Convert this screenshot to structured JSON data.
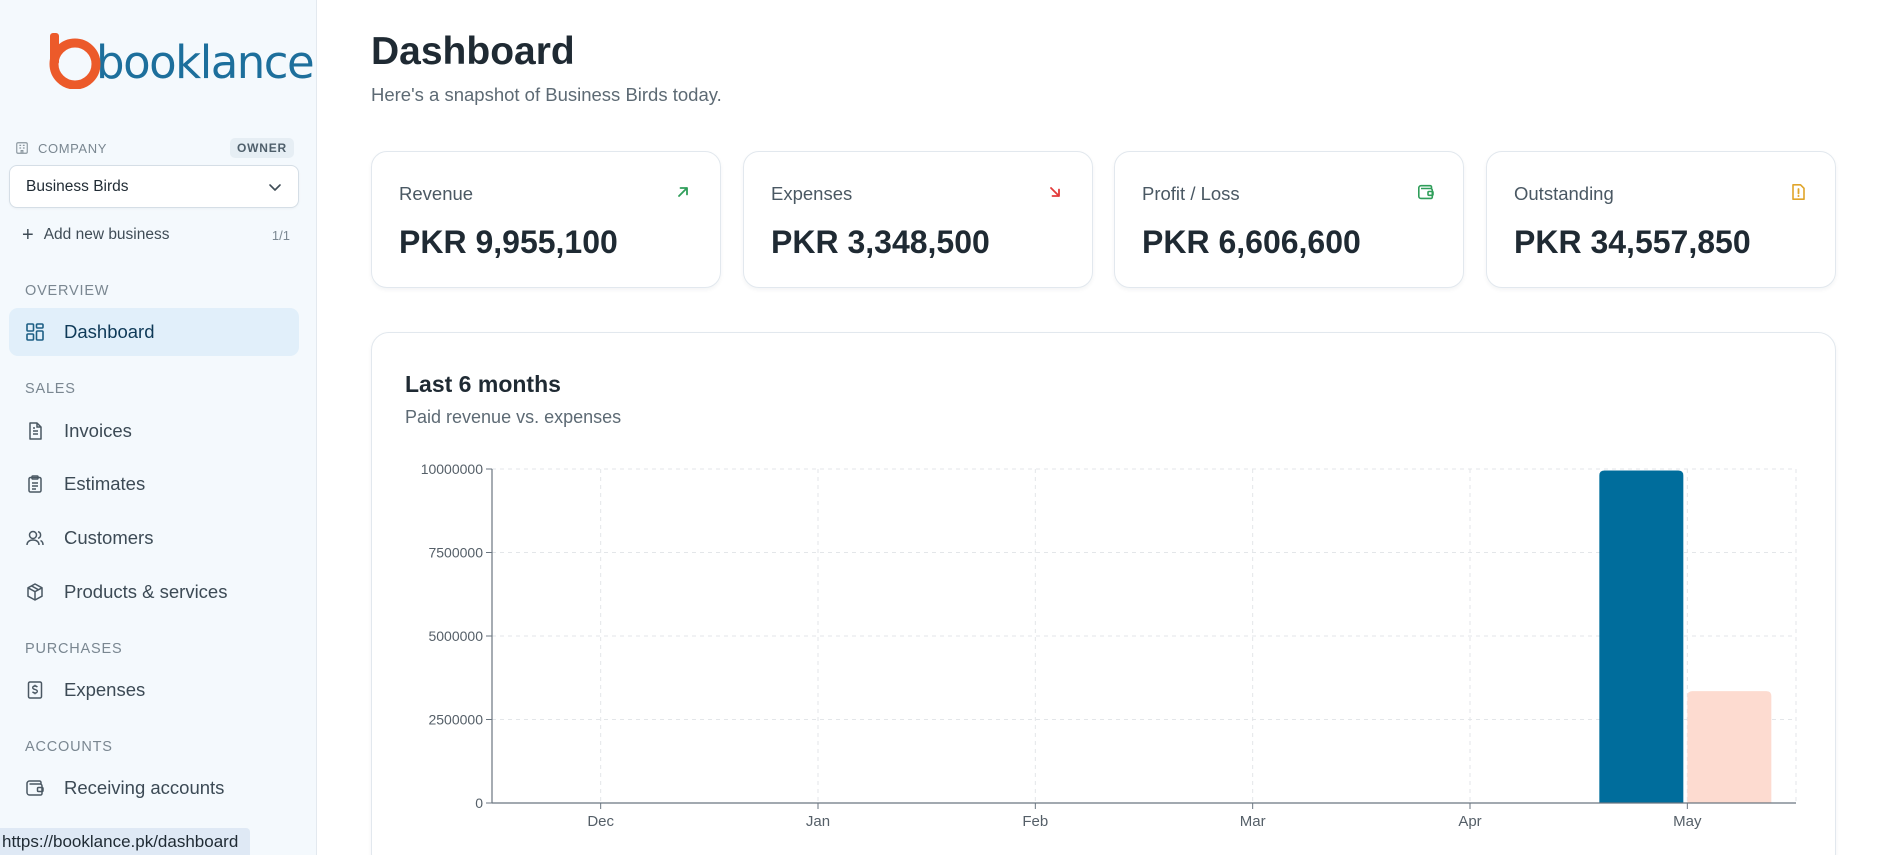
{
  "sidebar": {
    "logo_text": "booklance",
    "company_label": "COMPANY",
    "owner_badge": "OWNER",
    "company_selected": "Business Birds",
    "add_business": "Add new business",
    "business_count": "1/1",
    "sections": {
      "overview": "OVERVIEW",
      "sales": "SALES",
      "purchases": "PURCHASES",
      "accounts": "ACCOUNTS"
    },
    "items": {
      "dashboard": "Dashboard",
      "invoices": "Invoices",
      "estimates": "Estimates",
      "customers": "Customers",
      "products": "Products & services",
      "expenses": "Expenses",
      "receiving_accounts": "Receiving accounts"
    }
  },
  "status_url": "https://booklance.pk/dashboard",
  "header": {
    "title": "Dashboard",
    "subtitle": "Here's a snapshot of Business Birds today."
  },
  "cards": [
    {
      "label": "Revenue",
      "value": "PKR 9,955,100",
      "icon": "arrow-up-right-icon",
      "color": "#2f9e5a"
    },
    {
      "label": "Expenses",
      "value": "PKR 3,348,500",
      "icon": "arrow-down-right-icon",
      "color": "#e23b3b"
    },
    {
      "label": "Profit / Loss",
      "value": "PKR 6,606,600",
      "icon": "wallet-icon",
      "color": "#2f9e5a"
    },
    {
      "label": "Outstanding",
      "value": "PKR 34,557,850",
      "icon": "alert-note-icon",
      "color": "#e0a52a"
    }
  ],
  "chart_card": {
    "title": "Last 6 months",
    "subtitle": "Paid revenue vs. expenses"
  },
  "chart_data": {
    "type": "bar",
    "categories": [
      "Dec",
      "Jan",
      "Feb",
      "Mar",
      "Apr",
      "May"
    ],
    "series": [
      {
        "values": [
          0,
          0,
          0,
          0,
          0,
          9955100
        ],
        "color": "#006d9c"
      },
      {
        "values": [
          0,
          0,
          0,
          0,
          0,
          3348500
        ],
        "color": "#fddbd0"
      }
    ],
    "yticks": [
      "0",
      "2500000",
      "5000000",
      "7500000",
      "10000000"
    ],
    "ylim": [
      0,
      10000000
    ],
    "grid": true
  },
  "colors": {
    "brand_orange": "#ec5a2a",
    "brand_blue": "#1d6f9c",
    "active_nav_bg": "#e1effa"
  }
}
